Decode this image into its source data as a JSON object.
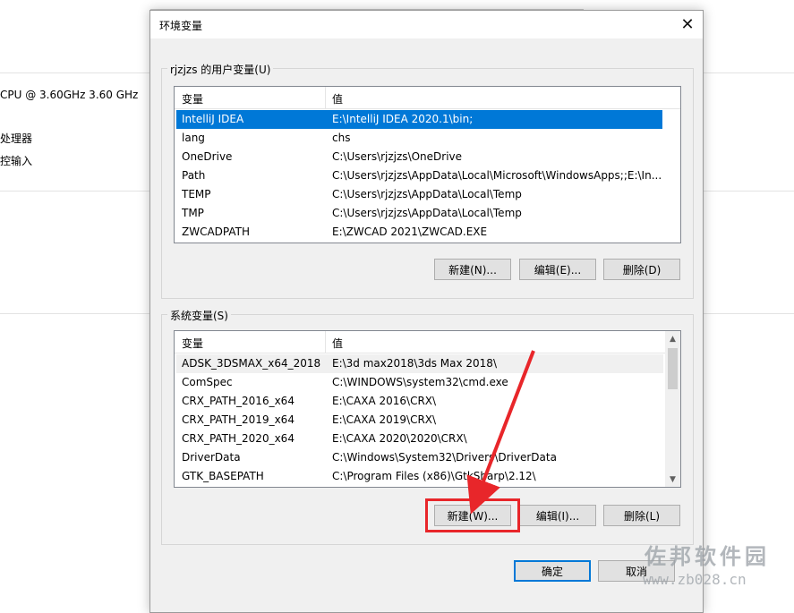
{
  "background": {
    "cpu_text": "CPU @ 3.60GHz    3.60 GHz",
    "processor_text": "处理器",
    "input_text": "控输入"
  },
  "dialog": {
    "title": "环境变量",
    "close_glyph": "✕",
    "user_group": {
      "label": "rjzjzs 的用户变量(U)",
      "columns": [
        "变量",
        "值"
      ],
      "rows": [
        {
          "name": "IntelliJ IDEA",
          "value": "E:\\IntelliJ IDEA 2020.1\\bin;"
        },
        {
          "name": "lang",
          "value": "chs"
        },
        {
          "name": "OneDrive",
          "value": "C:\\Users\\rjzjzs\\OneDrive"
        },
        {
          "name": "Path",
          "value": "C:\\Users\\rjzjzs\\AppData\\Local\\Microsoft\\WindowsApps;;E:\\In..."
        },
        {
          "name": "TEMP",
          "value": "C:\\Users\\rjzjzs\\AppData\\Local\\Temp"
        },
        {
          "name": "TMP",
          "value": "C:\\Users\\rjzjzs\\AppData\\Local\\Temp"
        },
        {
          "name": "ZWCADPATH",
          "value": "E:\\ZWCAD 2021\\ZWCAD.EXE"
        }
      ],
      "buttons": {
        "new": "新建(N)...",
        "edit": "编辑(E)...",
        "delete": "删除(D)"
      }
    },
    "system_group": {
      "label": "系统变量(S)",
      "columns": [
        "变量",
        "值"
      ],
      "rows": [
        {
          "name": "ADSK_3DSMAX_x64_2018",
          "value": "E:\\3d max2018\\3ds Max 2018\\"
        },
        {
          "name": "ComSpec",
          "value": "C:\\WINDOWS\\system32\\cmd.exe"
        },
        {
          "name": "CRX_PATH_2016_x64",
          "value": "E:\\CAXA 2016\\CRX\\"
        },
        {
          "name": "CRX_PATH_2019_x64",
          "value": "E:\\CAXA 2019\\CRX\\"
        },
        {
          "name": "CRX_PATH_2020_x64",
          "value": "E:\\CAXA 2020\\2020\\CRX\\"
        },
        {
          "name": "DriverData",
          "value": "C:\\Windows\\System32\\Drivers\\DriverData"
        },
        {
          "name": "GTK_BASEPATH",
          "value": "C:\\Program Files (x86)\\GtkSharp\\2.12\\"
        }
      ],
      "buttons": {
        "new": "新建(W)...",
        "edit": "编辑(I)...",
        "delete": "删除(L)"
      }
    },
    "ok_label": "确定",
    "cancel_label": "取消"
  },
  "annotation": {
    "color": "#e8262a"
  },
  "watermark": {
    "cn": "佐邦软件园",
    "url": "www.zb028.cn"
  },
  "colors": {
    "selection": "#0078d7",
    "dialog_bg": "#f0f0f0"
  }
}
